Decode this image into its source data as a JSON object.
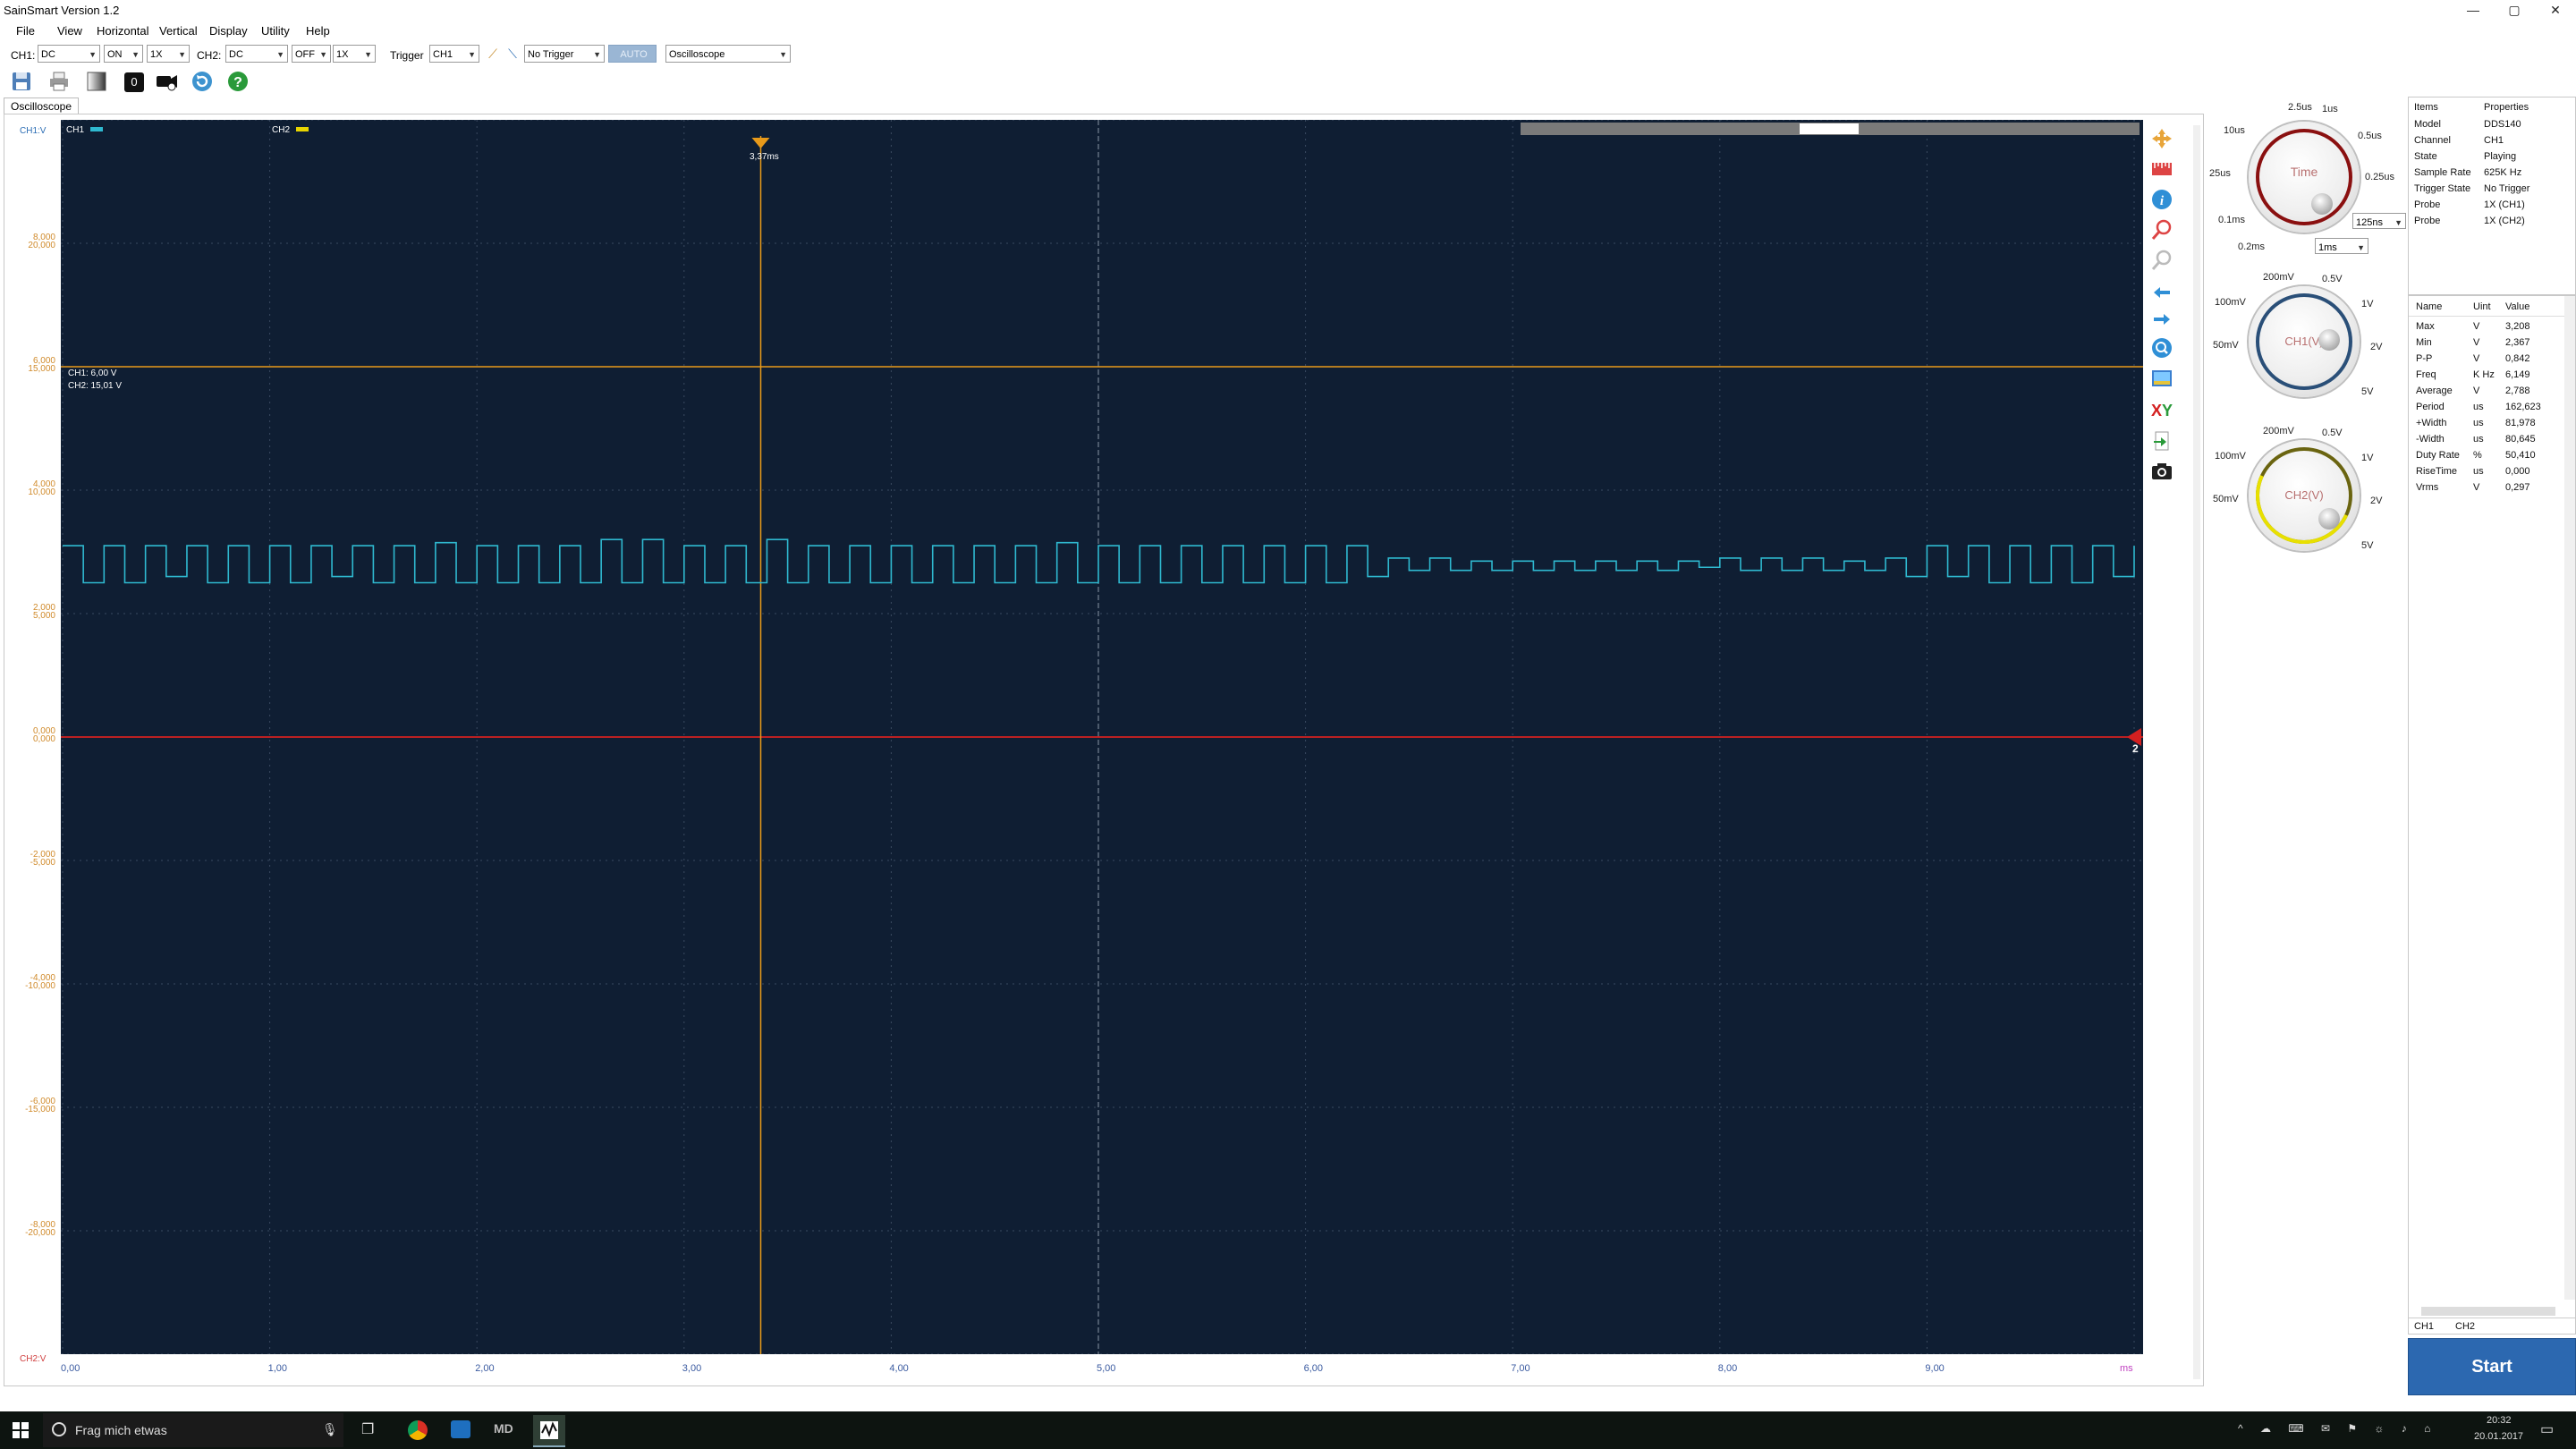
{
  "window": {
    "title": "SainSmart  Version 1.2",
    "min": "—",
    "max": "▢",
    "close": "✕"
  },
  "menu": [
    "File",
    "View",
    "Horizontal",
    "Vertical",
    "Display",
    "Utility",
    "Help"
  ],
  "controls": {
    "ch1_label": "CH1:",
    "ch1_coupling": "DC",
    "ch1_state": "ON",
    "ch1_probe": "1X",
    "ch2_label": "CH2:",
    "ch2_coupling": "DC",
    "ch2_state": "OFF",
    "ch2_probe": "1X",
    "trigger_label": "Trigger",
    "trigger_source": "CH1",
    "trigger_mode": "No Trigger",
    "auto_label": "AUTO",
    "mode": "Oscilloscope"
  },
  "toolbar": {
    "counter": "0"
  },
  "tab": {
    "label": "Oscilloscope"
  },
  "scope": {
    "ch1_axis_label": "CH1:V",
    "ch2_axis_label": "CH2:V",
    "ch1_tag": "CH1",
    "ch2_tag": "CH2",
    "cursor_label": "3,37ms",
    "level_ch1": "CH1: 6,00 V",
    "level_ch2": "CH2: 15,01 V",
    "marker_2": "2",
    "x_unit": "ms",
    "y_ch1": [
      "8,000",
      "6,000",
      "4,000",
      "2,000",
      "0,000",
      "-2,000",
      "-4,000",
      "-6,000",
      "-8,000"
    ],
    "y_ch2": [
      "20,000",
      "15,000",
      "10,000",
      "5,000",
      "0,000",
      "-5,000",
      "-10,000",
      "-15,000",
      "-20,000"
    ],
    "x_ticks": [
      "0,00",
      "1,00",
      "2,00",
      "3,00",
      "4,00",
      "5,00",
      "6,00",
      "7,00",
      "8,00",
      "9,00"
    ],
    "colors": {
      "background": "#0f1e33",
      "ch1": "#2fb9d0",
      "ch2": "#e8d400",
      "trigger": "#e89a1a",
      "zero": "#d42020"
    }
  },
  "chart_data": {
    "type": "line",
    "xlabel": "ms",
    "ylabel": "CH1:V",
    "xlim": [
      0,
      10
    ],
    "ylim": [
      -10,
      10
    ],
    "series": [
      {
        "name": "CH1",
        "x": [
          0.0,
          0.1,
          0.2,
          0.3,
          0.4,
          0.5,
          0.6,
          0.7,
          0.8,
          0.9,
          1.0,
          1.1,
          1.2,
          1.3,
          1.4,
          1.5,
          1.6,
          1.7,
          1.8,
          1.9,
          2.0,
          2.1,
          2.2,
          2.3,
          2.4,
          2.5,
          2.6,
          2.7,
          2.8,
          2.9,
          3.0,
          3.1,
          3.2,
          3.3,
          3.4,
          3.5,
          3.6,
          3.7,
          3.8,
          3.9,
          4.0,
          4.1,
          4.2,
          4.3,
          4.4,
          4.5,
          4.6,
          4.7,
          4.8,
          4.9,
          5.0,
          5.1,
          5.2,
          5.3,
          5.4,
          5.5,
          5.6,
          5.7,
          5.8,
          5.9,
          6.0,
          6.1,
          6.2,
          6.3,
          6.4,
          6.5,
          6.6,
          6.7,
          6.8,
          6.9,
          7.0,
          7.1,
          7.2,
          7.3,
          7.4,
          7.5,
          7.6,
          7.7,
          7.8,
          7.9,
          8.0,
          8.1,
          8.2,
          8.3,
          8.4,
          8.5,
          8.6,
          8.7,
          8.8,
          8.9,
          9.0,
          9.1,
          9.2,
          9.3,
          9.4,
          9.5,
          9.6,
          9.7,
          9.8,
          9.9,
          10.0
        ],
        "y": [
          3.1,
          2.5,
          3.1,
          2.5,
          3.1,
          2.6,
          3.1,
          2.5,
          3.1,
          2.5,
          3.1,
          2.5,
          3.1,
          2.6,
          3.1,
          2.5,
          3.1,
          2.5,
          3.15,
          2.5,
          3.1,
          2.5,
          3.1,
          2.5,
          3.1,
          2.5,
          3.2,
          2.5,
          3.2,
          2.5,
          3.1,
          2.5,
          3.1,
          2.5,
          3.2,
          2.5,
          3.1,
          2.5,
          3.1,
          2.5,
          3.1,
          2.5,
          3.1,
          2.5,
          3.1,
          2.5,
          3.1,
          2.5,
          3.15,
          2.5,
          3.1,
          2.5,
          3.1,
          2.5,
          3.1,
          2.5,
          3.1,
          2.5,
          3.1,
          2.5,
          3.1,
          2.5,
          3.1,
          2.6,
          2.9,
          2.7,
          2.9,
          2.7,
          2.85,
          2.7,
          2.85,
          2.7,
          2.85,
          2.7,
          2.85,
          2.7,
          2.85,
          2.7,
          2.85,
          2.75,
          2.9,
          2.7,
          2.9,
          2.7,
          2.9,
          2.7,
          2.85,
          2.7,
          2.9,
          2.6,
          3.1,
          2.6,
          3.1,
          2.5,
          3.1,
          2.5,
          3.1,
          2.5,
          3.1,
          2.6,
          3.1
        ]
      }
    ],
    "cursor_x": 3.37,
    "trigger_level": 6.0,
    "zero_level": 0
  },
  "knobs": {
    "time": {
      "label": "Time",
      "t1": "2.5us",
      "t2": "1us",
      "t3": "10us",
      "t4": "0.5us",
      "t5": "25us",
      "t6": "0.25us",
      "t7": "0.1ms",
      "t8": "0.2ms",
      "sel1": "125ns",
      "sel2": "1ms"
    },
    "ch1": {
      "label": "CH1(V)",
      "t1": "200mV",
      "t2": "0.5V",
      "t3": "100mV",
      "t4": "1V",
      "t5": "50mV",
      "t6": "2V",
      "t7": "5V"
    },
    "ch2": {
      "label": "CH2(V)",
      "t1": "200mV",
      "t2": "0.5V",
      "t3": "100mV",
      "t4": "1V",
      "t5": "50mV",
      "t6": "2V",
      "t7": "5V"
    }
  },
  "properties": {
    "header": [
      "Items",
      "Properties"
    ],
    "rows": [
      [
        "Model",
        "DDS140"
      ],
      [
        "Channel",
        "CH1"
      ],
      [
        "State",
        "Playing"
      ],
      [
        "Sample Rate",
        "625K Hz"
      ],
      [
        "Trigger State",
        "No Trigger"
      ],
      [
        "Probe",
        "1X (CH1)"
      ],
      [
        "Probe",
        "1X (CH2)"
      ]
    ]
  },
  "measurements": {
    "header": [
      "Name",
      "Uint",
      "Value"
    ],
    "rows": [
      [
        "Max",
        "V",
        "3,208"
      ],
      [
        "Min",
        "V",
        "2,367"
      ],
      [
        "P-P",
        "V",
        "0,842"
      ],
      [
        "Freq",
        "K Hz",
        "6,149"
      ],
      [
        "Average",
        "V",
        "2,788"
      ],
      [
        "Period",
        "us",
        "162,623"
      ],
      [
        "+Width",
        "us",
        "81,978"
      ],
      [
        "-Width",
        "us",
        "80,645"
      ],
      [
        "Duty Rate",
        "%",
        "50,410"
      ],
      [
        "RiseTime",
        "us",
        "0,000"
      ],
      [
        "Vrms",
        "V",
        "0,297"
      ]
    ],
    "tabs": [
      "CH1",
      "CH2"
    ]
  },
  "start_label": "Start",
  "taskbar": {
    "search": "Frag mich etwas",
    "time": "20:32",
    "date": "20.01.2017"
  }
}
